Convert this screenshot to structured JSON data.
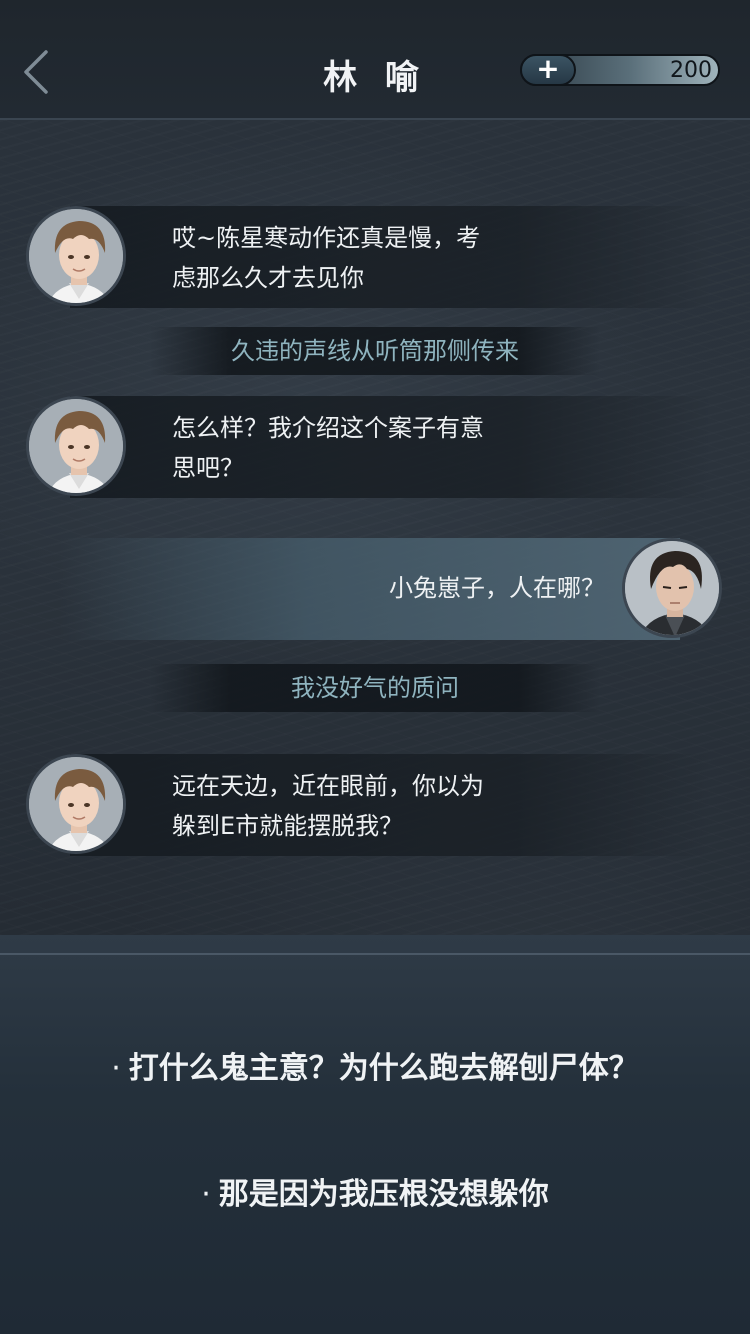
{
  "header": {
    "title": "林 喻",
    "energy_plus": "+",
    "energy_value": "200"
  },
  "messages": [
    {
      "side": "left",
      "speaker": "林喻",
      "avatar": "lin-yu-avatar",
      "text_lines": [
        "哎~陈星寒动作还真是慢，考",
        "虑那么久才去见你"
      ]
    },
    {
      "side": "left",
      "speaker": "林喻",
      "avatar": "lin-yu-avatar",
      "text_lines": [
        "怎么样？我介绍这个案子有意",
        "思吧？"
      ]
    },
    {
      "side": "right",
      "speaker": "player",
      "avatar": "player-avatar",
      "text_lines": [
        "小兔崽子，人在哪？"
      ]
    },
    {
      "side": "left",
      "speaker": "林喻",
      "avatar": "lin-yu-avatar",
      "text_lines": [
        "远在天边，近在眼前，你以为",
        "躲到E市就能摆脱我？"
      ]
    }
  ],
  "narrations": [
    {
      "text": "久违的声线从听筒那侧传来",
      "color": "#8fb4bf"
    },
    {
      "text": "我没好气的质问",
      "color": "#8fb4bf"
    }
  ],
  "options": [
    {
      "bullet": "·",
      "text": "打什么鬼主意？为什么跑去解刨尸体？"
    },
    {
      "bullet": "·",
      "text": "那是因为我压根没想躲你"
    }
  ],
  "colors": {
    "accent_teal": "#8fb4bf",
    "panel_bg": "#24303b",
    "topbar_bg": "#1f262d"
  }
}
